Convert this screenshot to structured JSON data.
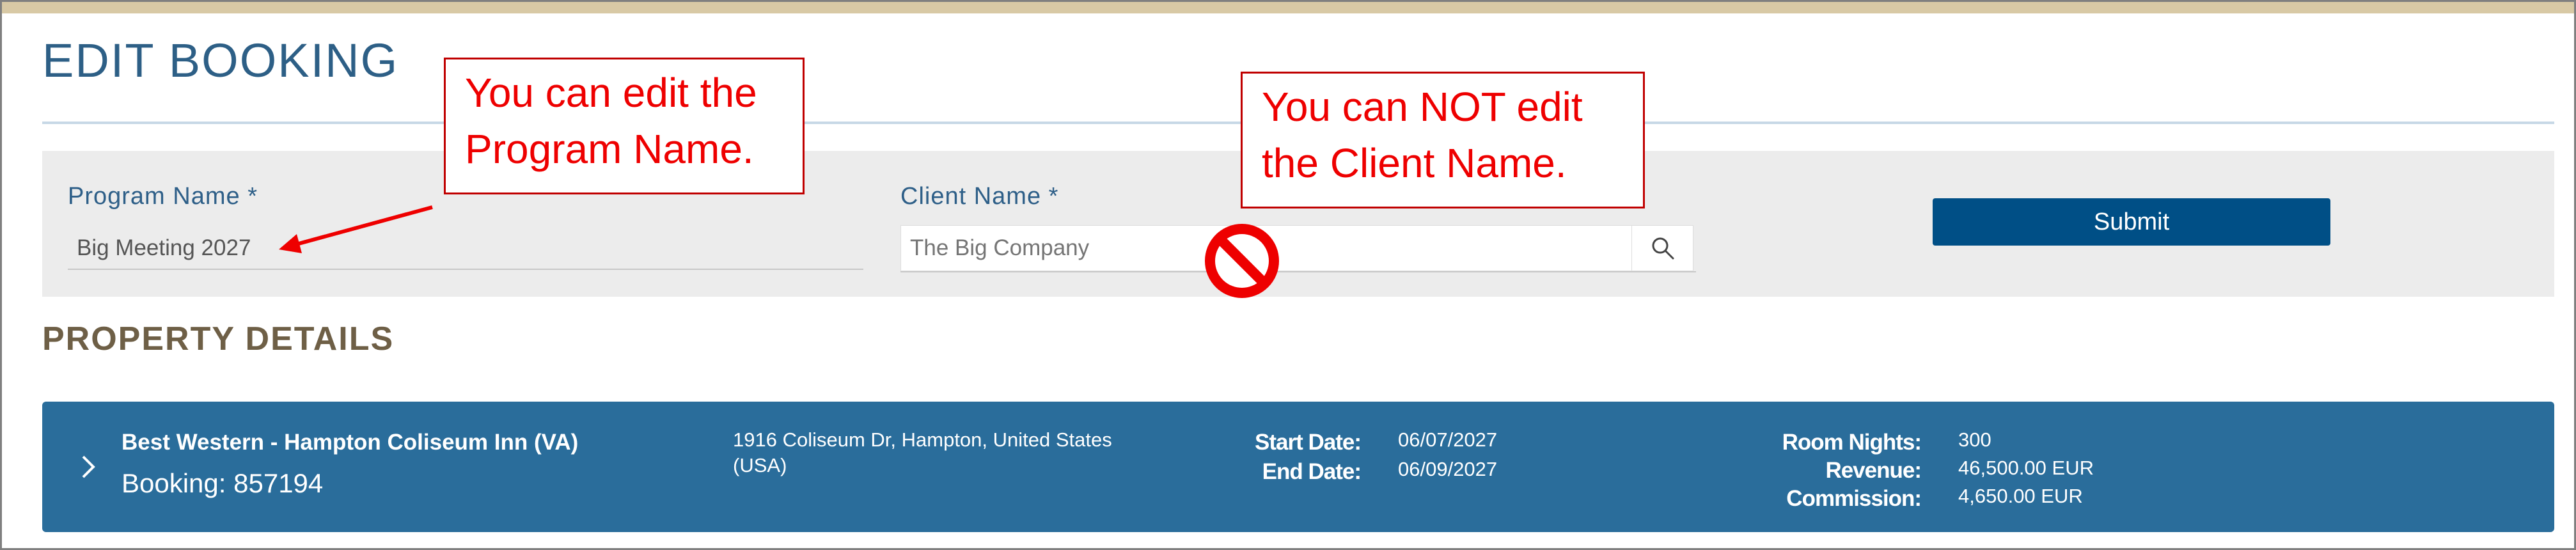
{
  "header": {
    "title": "EDIT BOOKING"
  },
  "form": {
    "program_label": "Program Name *",
    "program_value": "Big Meeting 2027",
    "client_label": "Client Name *",
    "client_placeholder": "The Big Company",
    "submit_label": "Submit"
  },
  "section": {
    "title": "PROPERTY DETAILS"
  },
  "property": {
    "hotel_name": "Best Western - Hampton Coliseum Inn (VA)",
    "booking": "Booking: 857194",
    "address_line1": "1916 Coliseum Dr, Hampton, United States",
    "address_line2": "(USA)",
    "start_date_label": "Start Date:",
    "start_date": "06/07/2027",
    "end_date_label": "End Date:",
    "end_date": "06/09/2027",
    "room_nights_label": "Room Nights:",
    "room_nights": "300",
    "revenue_label": "Revenue:",
    "revenue": "46,500.00 EUR",
    "commission_label": "Commission:",
    "commission": "4,650.00 EUR"
  },
  "annotations": {
    "can_edit_line1": "You can edit the",
    "can_edit_line2": "Program Name.",
    "cannot_edit_line1": "You can NOT edit",
    "cannot_edit_line2": "the Client Name."
  },
  "icons": {
    "search": "search-icon",
    "chevron": "chevron-right-icon",
    "prohibited": "no-entry-icon",
    "arrow": "arrow-icon"
  },
  "colors": {
    "accent_bar": "#d8c9a5",
    "primary": "#004f86",
    "card": "#2a6d9b",
    "annotation": "#ee0000"
  }
}
